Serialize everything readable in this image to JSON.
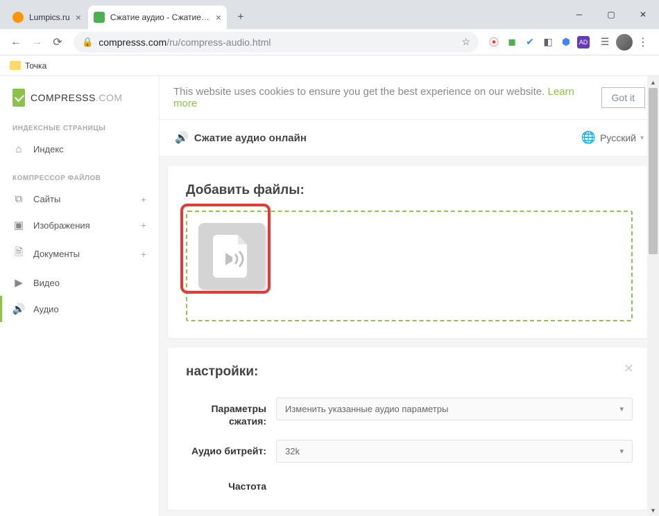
{
  "browser": {
    "tabs": [
      {
        "title": "Lumpics.ru"
      },
      {
        "title": "Сжатие аудио - Сжатие файлов"
      }
    ],
    "url_domain": "compresss.com",
    "url_path": "/ru/compress-audio.html",
    "bookmark": "Точка"
  },
  "logo": {
    "main": "COMPRESSS",
    "suffix": ".COM"
  },
  "sidebar": {
    "heading1": "ИНДЕКСНЫЕ СТРАНИЦЫ",
    "heading2": "КОМПРЕССОР ФАЙЛОВ",
    "items": {
      "index": "Индекс",
      "sites": "Сайты",
      "images": "Изображения",
      "documents": "Документы",
      "video": "Видео",
      "audio": "Аудио"
    }
  },
  "cookie": {
    "text": "This website uses cookies to ensure you get the best experience on our website. ",
    "learn_more": "Learn more",
    "got_it": "Got it"
  },
  "header": {
    "title": "Сжатие аудио онлайн",
    "language": "Русский"
  },
  "add_files": {
    "title": "Добавить файлы:"
  },
  "settings": {
    "title": "настройки:",
    "compression_label": "Параметры сжатия:",
    "compression_value": "Изменить указанные аудио параметры",
    "bitrate_label": "Аудио битрейт:",
    "bitrate_value": "32k",
    "frequency_label": "Частота"
  }
}
